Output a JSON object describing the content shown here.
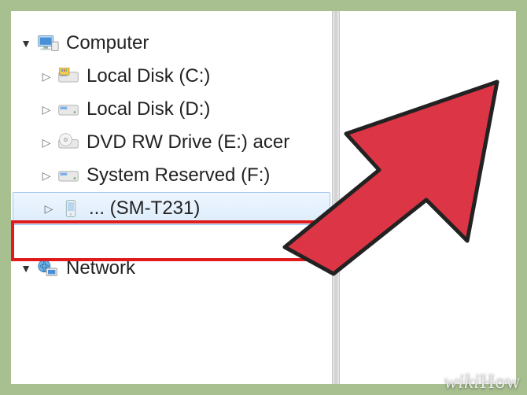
{
  "tree": {
    "root": {
      "label": "Computer"
    },
    "items": [
      {
        "label": "Local Disk (C:)"
      },
      {
        "label": "Local Disk (D:)"
      },
      {
        "label": "DVD RW Drive (E:) acer"
      },
      {
        "label": "System Reserved (F:)"
      },
      {
        "label": "... (SM-T231)"
      }
    ],
    "network": {
      "label": "Network"
    }
  },
  "watermark": "wikiHow"
}
